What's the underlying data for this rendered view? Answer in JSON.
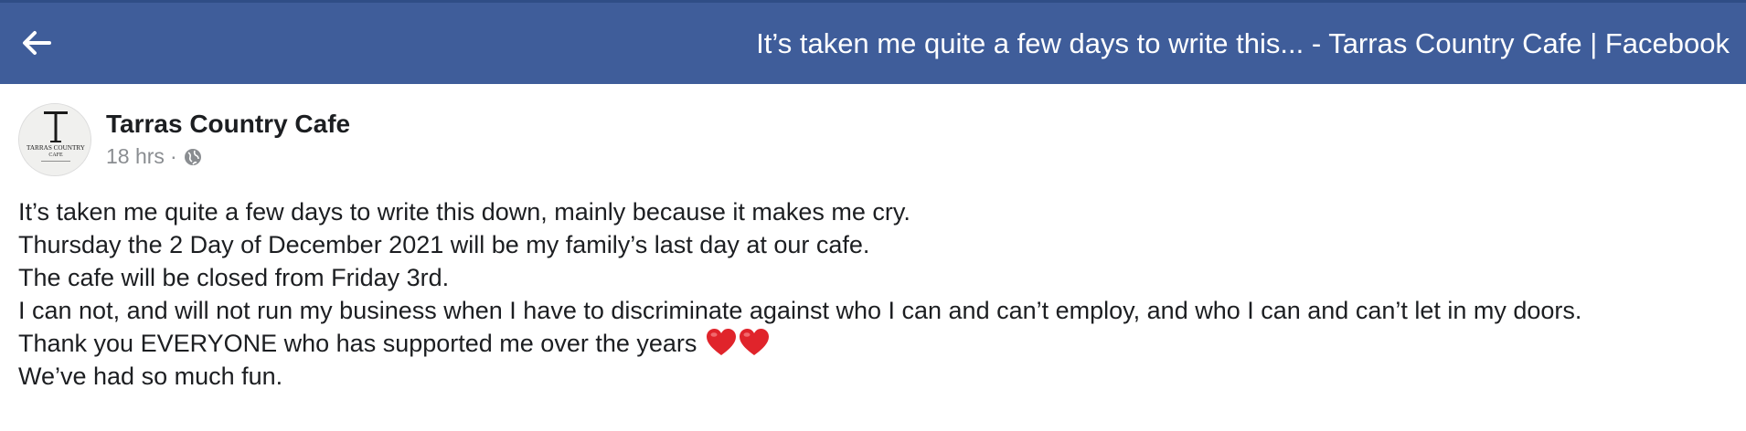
{
  "header": {
    "title": "It’s taken me quite a few days to write this... - Tarras Country Cafe | Facebook",
    "back_icon": "arrow-left-icon",
    "background_color": "#3f5d9a"
  },
  "post": {
    "author": "Tarras Country Cafe",
    "avatar_logo_text": {
      "line1": "TARRAS COUNTRY",
      "line2": "CAFE"
    },
    "timestamp": "18 hrs",
    "separator": "·",
    "audience_icon": "globe-icon",
    "lines": [
      "It’s taken me quite a few days to write this down, mainly because it makes me cry.",
      "Thursday the 2 Day of December 2021 will be my family’s last day at our cafe.",
      "The cafe will be closed from Friday 3rd.",
      "I can not, and will not run my business when I have to discriminate against who I can and can’t employ, and who I can and can’t let in my doors.",
      "Thank you EVERYONE who has supported me over the years",
      "We’ve had so much fun."
    ],
    "emoji": {
      "name": "red-heart-emoji",
      "count": 2,
      "color": "#e0242b"
    }
  }
}
